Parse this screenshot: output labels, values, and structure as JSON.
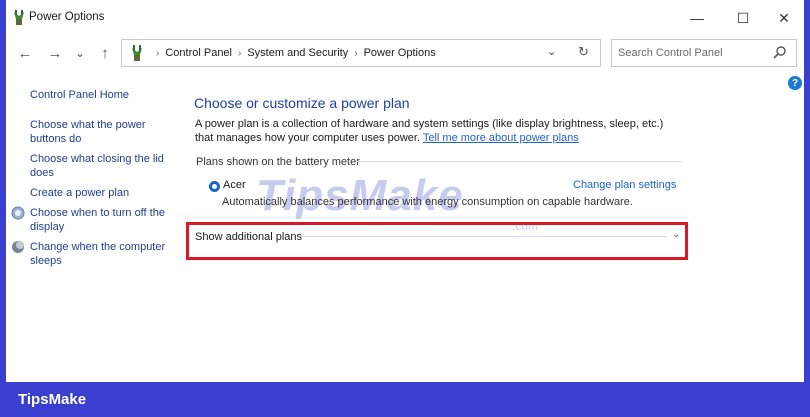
{
  "window": {
    "title": "Power Options",
    "minimize_glyph": "—",
    "maximize_glyph": "☐",
    "close_glyph": "✕"
  },
  "nav": {
    "back_glyph": "←",
    "forward_glyph": "→",
    "recent_glyph": "⌄",
    "up_glyph": "↑",
    "breadcrumbs": [
      "Control Panel",
      "System and Security",
      "Power Options"
    ],
    "separator": "›",
    "dropdown_glyph": "⌄",
    "refresh_glyph": "↻"
  },
  "search": {
    "placeholder": "Search Control Panel"
  },
  "help": {
    "label": "?"
  },
  "sidebar": {
    "items": [
      {
        "label": "Control Panel Home",
        "icon": ""
      },
      {
        "label": "Choose what the power\nbuttons do",
        "icon": ""
      },
      {
        "label": "Choose what closing the lid\ndoes",
        "icon": ""
      },
      {
        "label": "Create a power plan",
        "icon": ""
      },
      {
        "label": "Choose when to turn off the\ndisplay",
        "icon": "display-icon"
      },
      {
        "label": "Change when the computer\nsleeps",
        "icon": "moon-icon"
      }
    ]
  },
  "main": {
    "title": "Choose or customize a power plan",
    "description": "A power plan is a collection of hardware and system settings (like display brightness, sleep, etc.) that manages how your computer uses power. ",
    "description_link": "Tell me more about power plans",
    "group_label": "Plans shown on the battery meter",
    "plan": {
      "name": "Acer",
      "selected": true,
      "change_link": "Change plan settings",
      "description": "Automatically balances performance with energy consumption on capable hardware."
    },
    "additional_plans": {
      "label": "Show additional plans",
      "expanded": false
    }
  },
  "watermark": {
    "text": "TipsMake",
    "suffix": ".com"
  },
  "footer": {
    "brand": "TipsMake"
  },
  "colors": {
    "background": "#3a3fcf",
    "title_blue": "#1e3f9e",
    "link_blue": "#1f62c8",
    "highlight_red": "#d71a28"
  }
}
